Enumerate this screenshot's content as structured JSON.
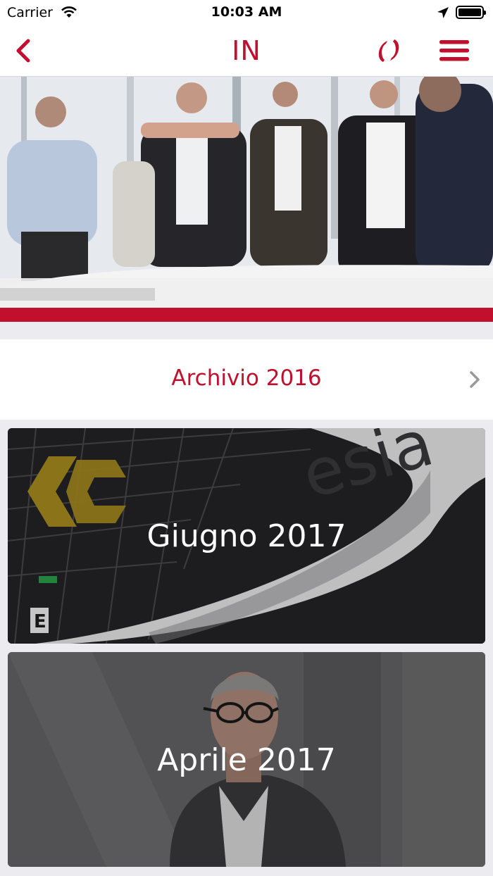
{
  "status_bar": {
    "carrier": "Carrier",
    "time": "10:03 AM"
  },
  "nav": {
    "title": "IN",
    "accent_color": "#c0102e",
    "back_icon": "chevron-left-icon",
    "logo_icon": "brand-logo-icon",
    "menu_icon": "hamburger-menu-icon"
  },
  "hero": {
    "image": "people-standing-around-table-photo"
  },
  "archive": {
    "label": "Archivio 2016",
    "icon": "chevron-right-icon"
  },
  "cards": [
    {
      "title": "Giugno 2017",
      "image": "coesia-booth-photo",
      "logo_text": "esia"
    },
    {
      "title": "Aprile 2017",
      "image": "man-with-glasses-portrait-photo"
    }
  ]
}
